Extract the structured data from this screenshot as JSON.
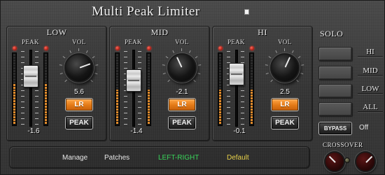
{
  "title": "Multi Peak Limiter",
  "bands": [
    {
      "name": "LOW",
      "peak_label": "PEAK",
      "vol_label": "VOL",
      "vol_value": "5.6",
      "peak_value": "-1.6",
      "lr_label": "LR",
      "peak_button": "PEAK",
      "knob_angle": 70,
      "fader_level": 0.72,
      "meter_level": 0.6
    },
    {
      "name": "MID",
      "peak_label": "PEAK",
      "vol_label": "VOL",
      "vol_value": "-2.1",
      "peak_value": "-1.4",
      "lr_label": "LR",
      "peak_button": "PEAK",
      "knob_angle": -25,
      "fader_level": 0.64,
      "meter_level": 0.5
    },
    {
      "name": "HI",
      "peak_label": "PEAK",
      "vol_label": "VOL",
      "vol_value": "2.5",
      "peak_value": "-0.1",
      "lr_label": "LR",
      "peak_button": "PEAK",
      "knob_angle": 25,
      "fader_level": 0.76,
      "meter_level": 0.5
    }
  ],
  "solo": {
    "title": "SOLO",
    "items": [
      "HI",
      "MID",
      "LOW",
      "ALL"
    ]
  },
  "bypass": {
    "label": "BYPASS",
    "state": "Off"
  },
  "footer": {
    "manage": "Manage",
    "patches": "Patches",
    "mode": "LEFT-RIGHT",
    "preset": "Default"
  },
  "crossover_label": "CROSSOVER",
  "colors": {
    "accent_orange": "#e37a17",
    "mode_green": "#39d45a",
    "preset_yellow": "#e8d14a"
  }
}
